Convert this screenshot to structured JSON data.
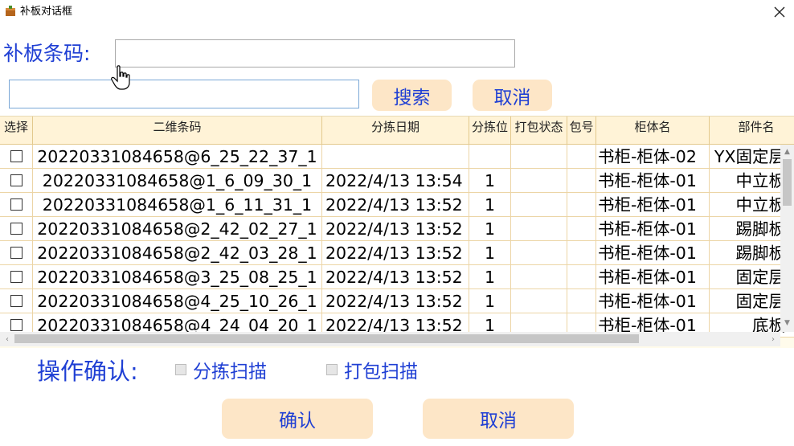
{
  "window": {
    "title": "补板对话框",
    "close_icon": "close-icon",
    "app_icon": "box-icon"
  },
  "barcode": {
    "label": "补板条码:",
    "value": ""
  },
  "search": {
    "value": "",
    "search_label": "搜索",
    "cancel_label": "取消"
  },
  "grid": {
    "headers": [
      "选择",
      "二维条码",
      "分拣日期",
      "分拣位",
      "打包状态",
      "包号",
      "柜体名",
      "部件名"
    ],
    "rows": [
      {
        "checked": false,
        "code": "20220331084658@6_25_22_37_1",
        "date": "",
        "pos": "",
        "print": "",
        "pkg": "",
        "cabinet": "书柜-柜体-02",
        "part": "YX固定层"
      },
      {
        "checked": false,
        "code": "20220331084658@1_6_09_30_1",
        "date": "2022/4/13 13:54",
        "pos": "1",
        "print": "",
        "pkg": "",
        "cabinet": "书柜-柜体-01",
        "part": "中立板"
      },
      {
        "checked": false,
        "code": "20220331084658@1_6_11_31_1",
        "date": "2022/4/13 13:52",
        "pos": "1",
        "print": "",
        "pkg": "",
        "cabinet": "书柜-柜体-01",
        "part": "中立板"
      },
      {
        "checked": false,
        "code": "20220331084658@2_42_02_27_1",
        "date": "2022/4/13 13:52",
        "pos": "1",
        "print": "",
        "pkg": "",
        "cabinet": "书柜-柜体-01",
        "part": "踢脚板"
      },
      {
        "checked": false,
        "code": "20220331084658@2_42_03_28_1",
        "date": "2022/4/13 13:52",
        "pos": "1",
        "print": "",
        "pkg": "",
        "cabinet": "书柜-柜体-01",
        "part": "踢脚板"
      },
      {
        "checked": false,
        "code": "20220331084658@3_25_08_25_1",
        "date": "2022/4/13 13:52",
        "pos": "1",
        "print": "",
        "pkg": "",
        "cabinet": "书柜-柜体-01",
        "part": "固定层"
      },
      {
        "checked": false,
        "code": "20220331084658@4_25_10_26_1",
        "date": "2022/4/13 13:52",
        "pos": "1",
        "print": "",
        "pkg": "",
        "cabinet": "书柜-柜体-01",
        "part": "固定层"
      },
      {
        "checked": false,
        "code": "20220331084658@4_24_04_20_1",
        "date": "2022/4/13 13:52",
        "pos": "1",
        "print": "",
        "pkg": "",
        "cabinet": "书柜-柜体-01",
        "part": "底板"
      }
    ]
  },
  "operation": {
    "label": "操作确认:",
    "options": [
      {
        "label": "分拣扫描",
        "checked": false
      },
      {
        "label": "打包扫描",
        "checked": false
      }
    ],
    "confirm_label": "确认",
    "cancel_label": "取消"
  },
  "colors": {
    "accent_text": "#1f3fd4",
    "button_bg": "#fde6c7",
    "grid_header_bg": "#fff3d7",
    "grid_border": "#e3c98d"
  }
}
